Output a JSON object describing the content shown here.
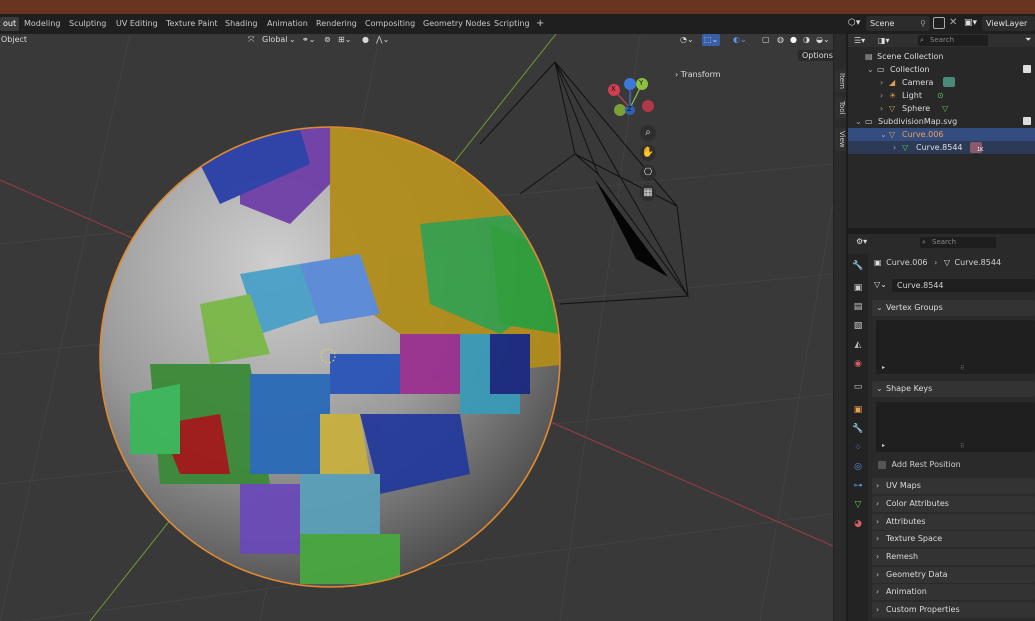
{
  "workspaces": [
    {
      "label": "out",
      "active": true
    },
    {
      "label": "Modeling"
    },
    {
      "label": "Sculpting"
    },
    {
      "label": "UV Editing"
    },
    {
      "label": "Texture Paint"
    },
    {
      "label": "Shading"
    },
    {
      "label": "Animation"
    },
    {
      "label": "Rendering"
    },
    {
      "label": "Compositing"
    },
    {
      "label": "Geometry Nodes"
    },
    {
      "label": "Scripting"
    }
  ],
  "add_tab": "+",
  "scene": {
    "name": "Scene",
    "view_layer": "ViewLayer"
  },
  "viewport": {
    "object_menu": "Object",
    "orientation": "Global",
    "options": "Options",
    "transform_label": "Transform",
    "side_tabs": [
      "Item",
      "Tool",
      "View"
    ],
    "gizmo_axes": {
      "x": "X",
      "y": "Y",
      "z": "Z"
    }
  },
  "outliner": {
    "search_placeholder": "Search",
    "rows": [
      {
        "label": "Scene Collection"
      },
      {
        "label": "Collection"
      },
      {
        "label": "Camera"
      },
      {
        "label": "Light"
      },
      {
        "label": "Sphere"
      },
      {
        "label": "SubdivisionMap.svg"
      },
      {
        "label": "Curve.006"
      },
      {
        "label": "Curve.8544"
      }
    ],
    "badge": "1K"
  },
  "properties": {
    "search_placeholder": "Search",
    "breadcrumb": [
      "Curve.006",
      "Curve.8544"
    ],
    "mesh_name": "Curve.8544",
    "panels": {
      "vertex_groups": "Vertex Groups",
      "shape_keys": "Shape Keys",
      "add_rest_position": "Add Rest Position",
      "uv_maps": "UV Maps",
      "color_attributes": "Color Attributes",
      "attributes": "Attributes",
      "texture_space": "Texture Space",
      "remesh": "Remesh",
      "geometry_data": "Geometry Data",
      "animation": "Animation",
      "custom_properties": "Custom Properties"
    }
  },
  "colors": {
    "selection": "#334d80",
    "accent_orange": "#f0a050",
    "mesh_green": "#5ac85a",
    "axis_red": "#d04050",
    "axis_green": "#8cc040",
    "axis_blue": "#3c78d8"
  }
}
